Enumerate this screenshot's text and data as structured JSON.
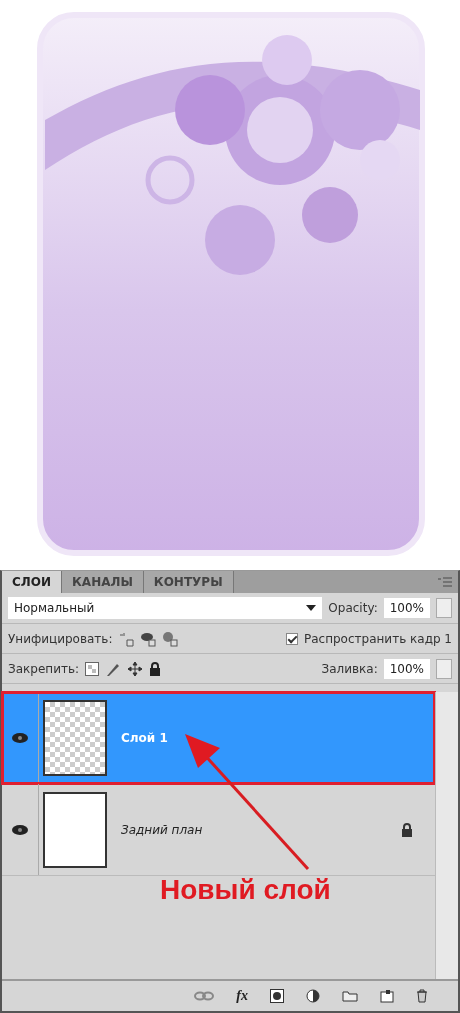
{
  "panel": {
    "tabs": [
      {
        "label": "СЛОИ",
        "selected": true
      },
      {
        "label": "КАНАЛЫ",
        "selected": false
      },
      {
        "label": "КОНТУРЫ",
        "selected": false
      }
    ],
    "blend_mode": "Нормальный",
    "opacity_label": "Opacity:",
    "opacity": "100%",
    "unify_label": "Унифицировать:",
    "propagate": {
      "label": "Распространить кадр 1",
      "checked": true
    },
    "lock_label": "Закрепить:",
    "fill_label": "Заливка:",
    "fill": "100%",
    "layers": [
      {
        "name": "Слой 1",
        "kind": "layer",
        "selected": true,
        "highlighted": true,
        "visible": true,
        "locked": false,
        "transparent": true
      },
      {
        "name": "Задний план",
        "kind": "background",
        "selected": false,
        "highlighted": false,
        "visible": true,
        "locked": true,
        "transparent": false
      }
    ],
    "footer_fx": "fx"
  },
  "annotation": {
    "text": "Новый слой"
  }
}
